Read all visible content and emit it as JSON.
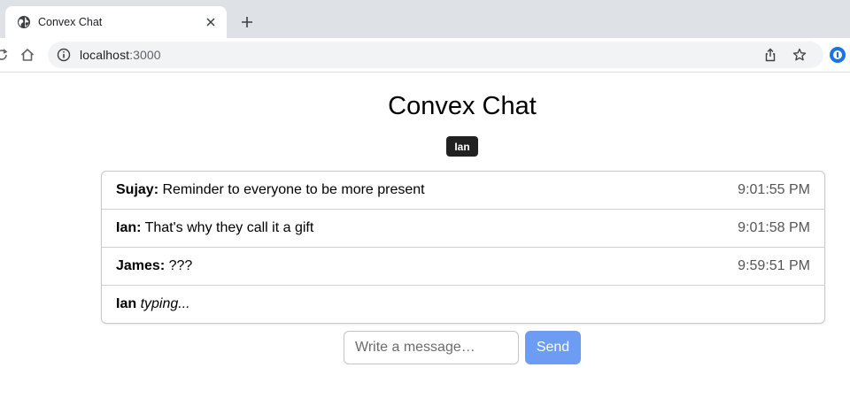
{
  "browser": {
    "tab_title": "Convex Chat",
    "url_host": "localhost",
    "url_port": ":3000"
  },
  "app": {
    "title": "Convex Chat",
    "current_user": "Ian"
  },
  "messages": [
    {
      "author": "Sujay:",
      "body": "Reminder to everyone to be more present",
      "time": "9:01:55 PM"
    },
    {
      "author": "Ian:",
      "body": "That's why they call it a gift",
      "time": "9:01:58 PM"
    },
    {
      "author": "James:",
      "body": "???",
      "time": "9:59:51 PM"
    }
  ],
  "typing": {
    "author": "Ian",
    "body": "typing..."
  },
  "composer": {
    "placeholder": "Write a message…",
    "send_label": "Send"
  },
  "colors": {
    "send_button": "#6d9df3",
    "badge": "#212121"
  }
}
